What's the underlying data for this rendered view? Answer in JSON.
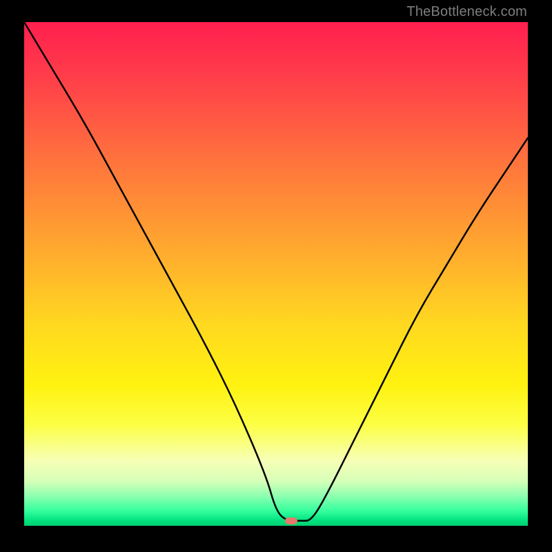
{
  "watermark": "TheBottleneck.com",
  "chart_data": {
    "type": "line",
    "title": "",
    "xlabel": "",
    "ylabel": "",
    "xlim": [
      0,
      100
    ],
    "ylim": [
      0,
      100
    ],
    "background_gradient": {
      "stops": [
        {
          "pos": 0,
          "color": "#ff1f4f"
        },
        {
          "pos": 45,
          "color": "#ffa92f"
        },
        {
          "pos": 72,
          "color": "#fff210"
        },
        {
          "pos": 94,
          "color": "#8fffb0"
        },
        {
          "pos": 100,
          "color": "#00d072"
        }
      ]
    },
    "series": [
      {
        "name": "bottleneck-curve",
        "color": "#000000",
        "x": [
          0,
          6,
          12,
          18,
          24,
          30,
          36,
          42,
          48,
          50,
          52,
          55,
          57,
          60,
          66,
          72,
          78,
          84,
          90,
          96,
          100
        ],
        "values": [
          100,
          90,
          80,
          69,
          58,
          47,
          36,
          24,
          10,
          3,
          1,
          1,
          1,
          6,
          18,
          30,
          42,
          52,
          62,
          71,
          77
        ]
      }
    ],
    "marker": {
      "x": 53,
      "y": 1,
      "color": "#e47a6a"
    }
  }
}
